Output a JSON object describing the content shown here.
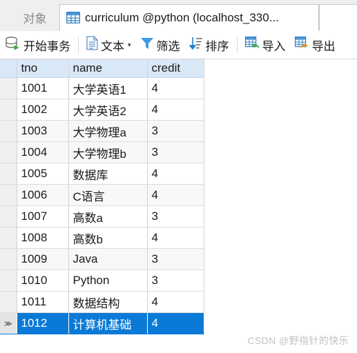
{
  "window": {
    "accent_color": "#0a7ad6",
    "header_color": "#d9e8f7"
  },
  "tabs": {
    "objects": {
      "label": "对象",
      "icon": "objects-tab",
      "active": false
    },
    "table": {
      "label": "curriculum @python (localhost_330...",
      "icon": "grid-icon",
      "active": true
    }
  },
  "toolbar": {
    "begin_transaction": {
      "label": "开始事务",
      "icon": "database-play-icon"
    },
    "text": {
      "label": "文本",
      "icon": "document-text-icon",
      "caret": "▾"
    },
    "filter": {
      "label": "筛选",
      "icon": "funnel-icon"
    },
    "sort": {
      "label": "排序",
      "icon": "sort-descending-icon"
    },
    "import": {
      "label": "导入",
      "icon": "import-grid-icon"
    },
    "export": {
      "label": "导出",
      "icon": "export-grid-icon"
    }
  },
  "grid": {
    "columns": [
      {
        "key": "tno",
        "label": "tno",
        "align": "left"
      },
      {
        "key": "name",
        "label": "name",
        "align": "left"
      },
      {
        "key": "credit",
        "label": "credit",
        "align": "right"
      }
    ],
    "row_indicator_selected": "≫",
    "rows": [
      {
        "tno": "1001",
        "name": "大学英语1",
        "credit": "4",
        "alt": false,
        "selected": false
      },
      {
        "tno": "1002",
        "name": "大学英语2",
        "credit": "4",
        "alt": false,
        "selected": false
      },
      {
        "tno": "1003",
        "name": "大学物理a",
        "credit": "3",
        "alt": true,
        "selected": false
      },
      {
        "tno": "1004",
        "name": "大学物理b",
        "credit": "3",
        "alt": true,
        "selected": false
      },
      {
        "tno": "1005",
        "name": "数据库",
        "credit": "4",
        "alt": false,
        "selected": false
      },
      {
        "tno": "1006",
        "name": "C语言",
        "credit": "4",
        "alt": true,
        "selected": false
      },
      {
        "tno": "1007",
        "name": "高数a",
        "credit": "3",
        "alt": false,
        "selected": false
      },
      {
        "tno": "1008",
        "name": "高数b",
        "credit": "4",
        "alt": false,
        "selected": false
      },
      {
        "tno": "1009",
        "name": "Java",
        "credit": "3",
        "alt": true,
        "selected": false
      },
      {
        "tno": "1010",
        "name": "Python",
        "credit": "3",
        "alt": false,
        "selected": false
      },
      {
        "tno": "1011",
        "name": "数据结构",
        "credit": "4",
        "alt": false,
        "selected": false
      },
      {
        "tno": "1012",
        "name": "计算机基础",
        "credit": "4",
        "alt": false,
        "selected": true
      }
    ]
  },
  "watermark": {
    "text": "CSDN @野指针的快乐"
  }
}
